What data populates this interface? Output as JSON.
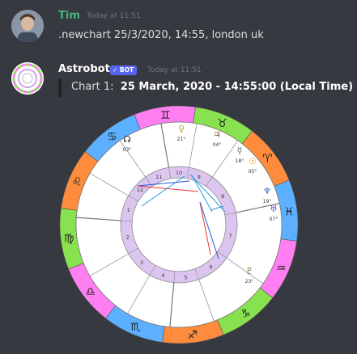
{
  "messages": [
    {
      "author": "Tim",
      "author_color": "#43b581",
      "timestamp": "Today at 11:51",
      "text": ".newchart 25/3/2020, 14:55, london uk"
    },
    {
      "author": "Astrobot",
      "author_color": "#ffffff",
      "bot_tag": "✓ BOT",
      "timestamp": "Today at 11:51",
      "embed": {
        "label": "Chart 1:",
        "value": "25 March, 2020 - 14:55:00 (Local Time)"
      }
    }
  ],
  "chart": {
    "zodiac_signs": [
      {
        "glyph": "♉",
        "color": "#88e14e"
      },
      {
        "glyph": "♈",
        "color": "#ff8c3c"
      },
      {
        "glyph": "♓",
        "color": "#5cb0ff"
      },
      {
        "glyph": "♒",
        "color": "#ff7ef2"
      },
      {
        "glyph": "♑",
        "color": "#88e14e"
      },
      {
        "glyph": "♐",
        "color": "#ff8c3c"
      },
      {
        "glyph": "♏",
        "color": "#5cb0ff"
      },
      {
        "glyph": "♎",
        "color": "#ff7ef2"
      },
      {
        "glyph": "♍",
        "color": "#88e14e"
      },
      {
        "glyph": "♌",
        "color": "#ff8c3c"
      },
      {
        "glyph": "♋",
        "color": "#5cb0ff"
      },
      {
        "glyph": "♊",
        "color": "#ff7ef2"
      }
    ],
    "house_numbers": [
      "10",
      "9",
      "8",
      "7",
      "6",
      "5",
      "4",
      "3",
      "2",
      "1",
      "12",
      "11"
    ],
    "planets": [
      {
        "glyph": "♀",
        "deg": "21°",
        "color": "#c0a020"
      },
      {
        "glyph": "♃",
        "deg": "04°",
        "color": "#8a6d3b"
      },
      {
        "glyph": "☉",
        "deg": "05°",
        "color": "#e0a000"
      },
      {
        "glyph": "☿",
        "deg": "18°",
        "color": "#6a6a6a"
      },
      {
        "glyph": "♆",
        "deg": "19°",
        "color": "#2266cc"
      },
      {
        "glyph": "♅",
        "deg": "07°",
        "color": "#6a4ccc"
      },
      {
        "glyph": "♇",
        "deg": "23°",
        "color": "#8a6d3b"
      },
      {
        "glyph": "☊",
        "deg": "03°",
        "color": "#222"
      }
    ]
  }
}
